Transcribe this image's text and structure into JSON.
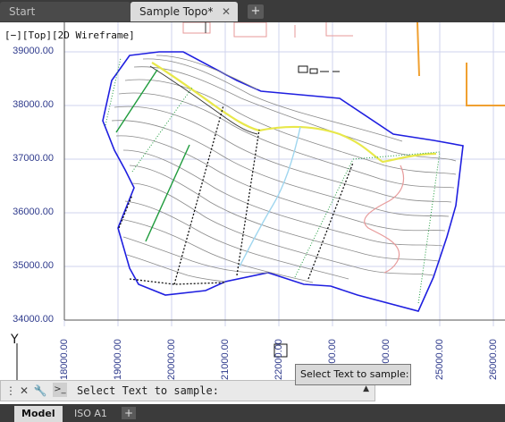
{
  "tabs": [
    {
      "label": "Start"
    },
    {
      "label": "Sample Topo*"
    }
  ],
  "viewport_label": "[−][Top][2D Wireframe]",
  "y_axis_labels": [
    "39000.00",
    "38000.00",
    "37000.00",
    "36000.00",
    "35000.00",
    "34000.00"
  ],
  "x_axis_labels": [
    "18000.00",
    "19000.00",
    "20000.00",
    "21000.00",
    "22000.00",
    "23000.00",
    "24000.00",
    "25000.00",
    "26000.00"
  ],
  "ucs_label": "Y",
  "command_line": {
    "text": "Select Text to sample:"
  },
  "tooltip": "Select Text to sample:",
  "layout_tabs": [
    "Model",
    "ISO A1"
  ],
  "colors": {
    "boundary": "#1f1fe0",
    "road": "#e8e84a",
    "stream": "#9fd6ef",
    "drive": "#e79a9a",
    "green_line": "#1e9b3c",
    "axis_text": "#2e3a8c",
    "grid": "#cfd3ec"
  }
}
